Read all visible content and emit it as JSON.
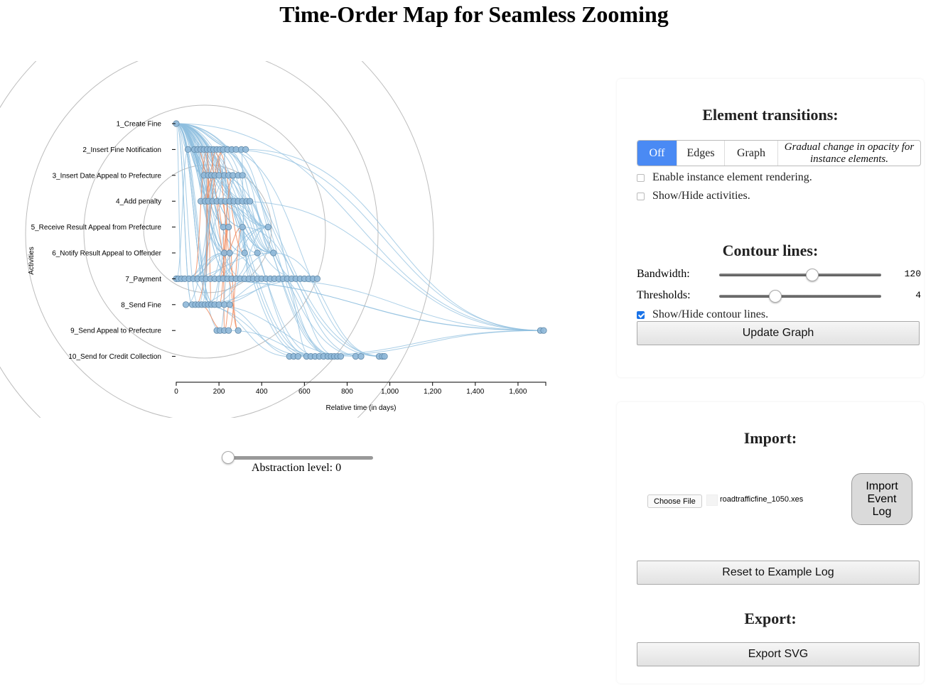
{
  "page": {
    "title": "Time-Order Map for Seamless Zooming"
  },
  "chart_data": {
    "type": "scatter",
    "xlabel": "Relative time (in days)",
    "ylabel": "Activities",
    "xlim": [
      0,
      1730
    ],
    "xticks": [
      0,
      200,
      400,
      600,
      800,
      1000,
      1200,
      1400,
      1600
    ],
    "xtick_labels": [
      "0",
      "200",
      "400",
      "600",
      "800",
      "1,000",
      "1,200",
      "1,400",
      "1,600"
    ],
    "activities": [
      "1_Create Fine",
      "2_Insert Fine Notification",
      "3_Insert Date Appeal to Prefecture",
      "4_Add penalty",
      "5_Receive Result Appeal from Prefecture",
      "6_Notify Result Appeal to Offender",
      "7_Payment",
      "8_Send Fine",
      "9_Send Appeal to Prefecture",
      "10_Send for Credit Collection"
    ],
    "points": [
      [
        0,
        0
      ],
      [
        55,
        1
      ],
      [
        85,
        1
      ],
      [
        100,
        1
      ],
      [
        115,
        1
      ],
      [
        130,
        1
      ],
      [
        145,
        1
      ],
      [
        160,
        1
      ],
      [
        175,
        1
      ],
      [
        190,
        1
      ],
      [
        205,
        1
      ],
      [
        220,
        1
      ],
      [
        240,
        1
      ],
      [
        260,
        1
      ],
      [
        280,
        1
      ],
      [
        305,
        1
      ],
      [
        325,
        1
      ],
      [
        130,
        2
      ],
      [
        150,
        2
      ],
      [
        165,
        2
      ],
      [
        180,
        2
      ],
      [
        200,
        2
      ],
      [
        225,
        2
      ],
      [
        245,
        2
      ],
      [
        265,
        2
      ],
      [
        290,
        2
      ],
      [
        310,
        2
      ],
      [
        115,
        3
      ],
      [
        135,
        3
      ],
      [
        150,
        3
      ],
      [
        170,
        3
      ],
      [
        190,
        3
      ],
      [
        210,
        3
      ],
      [
        230,
        3
      ],
      [
        250,
        3
      ],
      [
        270,
        3
      ],
      [
        290,
        3
      ],
      [
        310,
        3
      ],
      [
        330,
        3
      ],
      [
        345,
        3
      ],
      [
        220,
        4
      ],
      [
        245,
        4
      ],
      [
        310,
        4
      ],
      [
        430,
        4
      ],
      [
        225,
        5
      ],
      [
        250,
        5
      ],
      [
        320,
        5
      ],
      [
        380,
        5
      ],
      [
        455,
        5
      ],
      [
        0,
        6
      ],
      [
        10,
        6
      ],
      [
        25,
        6
      ],
      [
        40,
        6
      ],
      [
        60,
        6
      ],
      [
        80,
        6
      ],
      [
        100,
        6
      ],
      [
        120,
        6
      ],
      [
        140,
        6
      ],
      [
        160,
        6
      ],
      [
        180,
        6
      ],
      [
        200,
        6
      ],
      [
        220,
        6
      ],
      [
        240,
        6
      ],
      [
        260,
        6
      ],
      [
        280,
        6
      ],
      [
        300,
        6
      ],
      [
        320,
        6
      ],
      [
        340,
        6
      ],
      [
        360,
        6
      ],
      [
        380,
        6
      ],
      [
        400,
        6
      ],
      [
        420,
        6
      ],
      [
        440,
        6
      ],
      [
        460,
        6
      ],
      [
        480,
        6
      ],
      [
        500,
        6
      ],
      [
        520,
        6
      ],
      [
        540,
        6
      ],
      [
        560,
        6
      ],
      [
        580,
        6
      ],
      [
        600,
        6
      ],
      [
        620,
        6
      ],
      [
        640,
        6
      ],
      [
        660,
        6
      ],
      [
        45,
        7
      ],
      [
        75,
        7
      ],
      [
        90,
        7
      ],
      [
        105,
        7
      ],
      [
        120,
        7
      ],
      [
        135,
        7
      ],
      [
        150,
        7
      ],
      [
        165,
        7
      ],
      [
        180,
        7
      ],
      [
        200,
        7
      ],
      [
        225,
        7
      ],
      [
        250,
        7
      ],
      [
        190,
        8
      ],
      [
        205,
        8
      ],
      [
        225,
        8
      ],
      [
        245,
        8
      ],
      [
        290,
        8
      ],
      [
        1705,
        8
      ],
      [
        1720,
        8
      ],
      [
        530,
        9
      ],
      [
        550,
        9
      ],
      [
        570,
        9
      ],
      [
        610,
        9
      ],
      [
        630,
        9
      ],
      [
        650,
        9
      ],
      [
        670,
        9
      ],
      [
        690,
        9
      ],
      [
        710,
        9
      ],
      [
        725,
        9
      ],
      [
        740,
        9
      ],
      [
        755,
        9
      ],
      [
        770,
        9
      ],
      [
        840,
        9
      ],
      [
        865,
        9
      ],
      [
        950,
        9
      ],
      [
        965,
        9
      ],
      [
        975,
        9
      ]
    ],
    "colors": {
      "points": "#8fb8d8",
      "edges": "#8fbfdf",
      "highlight_edges": "#f08a5d",
      "contours": "#bdbdbd"
    }
  },
  "abstraction": {
    "label": "Abstraction level: 0",
    "value": 0
  },
  "transitions": {
    "title": "Element transitions:",
    "options": [
      "Off",
      "Edges",
      "Graph"
    ],
    "selected": "Off",
    "description": "Gradual change in opacity for instance elements.",
    "enable_instance_label": "Enable instance element rendering.",
    "show_activities_label": "Show/Hide activities."
  },
  "contours": {
    "title": "Contour lines:",
    "bandwidth_label": "Bandwidth:",
    "bandwidth_value": "120",
    "bandwidth_level": 0.57,
    "thresholds_label": "Thresholds:",
    "thresholds_value": "4",
    "thresholds_level": 0.34,
    "show_lines_label": "Show/Hide contour lines.",
    "update_button": "Update Graph"
  },
  "import": {
    "title": "Import:",
    "choose_file": "Choose File",
    "file_name": "roadtrafficfine_1050.xes",
    "import_button": "Import Event Log",
    "reset_button": "Reset to Example Log"
  },
  "export": {
    "title": "Export:",
    "svg_button": "Export SVG"
  }
}
